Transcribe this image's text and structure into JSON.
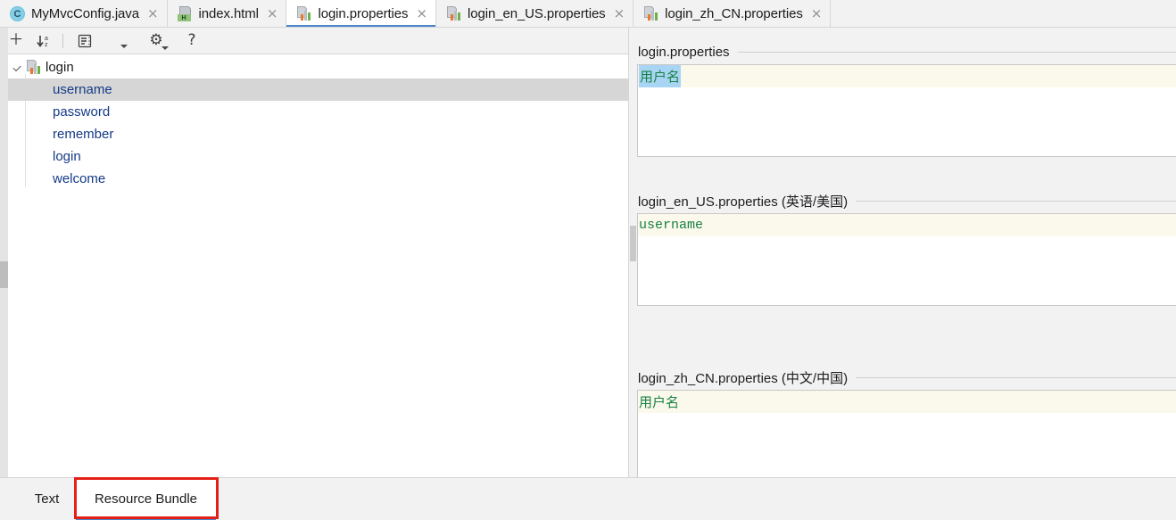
{
  "window": {
    "accent_color": "#4a86c8",
    "annotation_color": "#e32119",
    "key_text_color": "#143a87",
    "value_text_color": "#178243",
    "selection_color": "#a9d5f5",
    "current_line_color": "#fbf8ec"
  },
  "editor_tabs": [
    {
      "label": "MyMvcConfig.java",
      "icon": "java-class-icon",
      "active": false,
      "close_glyph": "×"
    },
    {
      "label": "index.html",
      "icon": "html-file-icon",
      "active": false,
      "close_glyph": "×"
    },
    {
      "label": "login.properties",
      "icon": "resource-bundle-icon",
      "active": true,
      "close_glyph": "×"
    },
    {
      "label": "login_en_US.properties",
      "icon": "resource-bundle-icon",
      "active": false,
      "close_glyph": "×"
    },
    {
      "label": "login_zh_CN.properties",
      "icon": "resource-bundle-icon",
      "active": false,
      "close_glyph": "×"
    }
  ],
  "toolbar": {
    "buttons": [
      {
        "name": "add-property-button",
        "icon": "plus-icon",
        "glyph": "＋",
        "tooltip": "Add Property"
      },
      {
        "name": "sort-button",
        "icon": "sort-az-icon",
        "glyph": "↓",
        "sub": "a\nz",
        "tooltip": "Sort Alphabetically"
      },
      {
        "name": "group-button",
        "icon": "group-list-icon",
        "glyph": "⌸",
        "tooltip": "Group by Prefix"
      },
      {
        "name": "group-dropdown",
        "icon": "chevron-down-icon",
        "glyph": "",
        "tooltip": "Show Options"
      },
      {
        "name": "settings-button",
        "icon": "gear-icon",
        "glyph": "⚙",
        "tooltip": "Settings"
      },
      {
        "name": "help-button",
        "icon": "help-icon",
        "glyph": "?",
        "tooltip": "Help"
      }
    ]
  },
  "tree": {
    "root": {
      "label": "login",
      "icon": "resource-bundle-icon",
      "expanded": true,
      "chevron": "chevron-down-icon"
    },
    "keys": [
      {
        "label": "username",
        "selected": true
      },
      {
        "label": "password",
        "selected": false
      },
      {
        "label": "remember",
        "selected": false
      },
      {
        "label": "login",
        "selected": false
      },
      {
        "label": "welcome",
        "selected": false
      }
    ]
  },
  "value_editors": [
    {
      "title": "login.properties",
      "value": "用户名",
      "value_selected": true,
      "cjk": true
    },
    {
      "title": "login_en_US.properties (英语/美国)",
      "value": "username",
      "value_selected": false,
      "cjk": false
    },
    {
      "title": "login_zh_CN.properties (中文/中国)",
      "value": "用户名",
      "value_selected": false,
      "cjk": true
    }
  ],
  "view_tabs": [
    {
      "label": "Text",
      "active": false,
      "annotated": false
    },
    {
      "label": "Resource Bundle",
      "active": true,
      "annotated": true
    }
  ]
}
